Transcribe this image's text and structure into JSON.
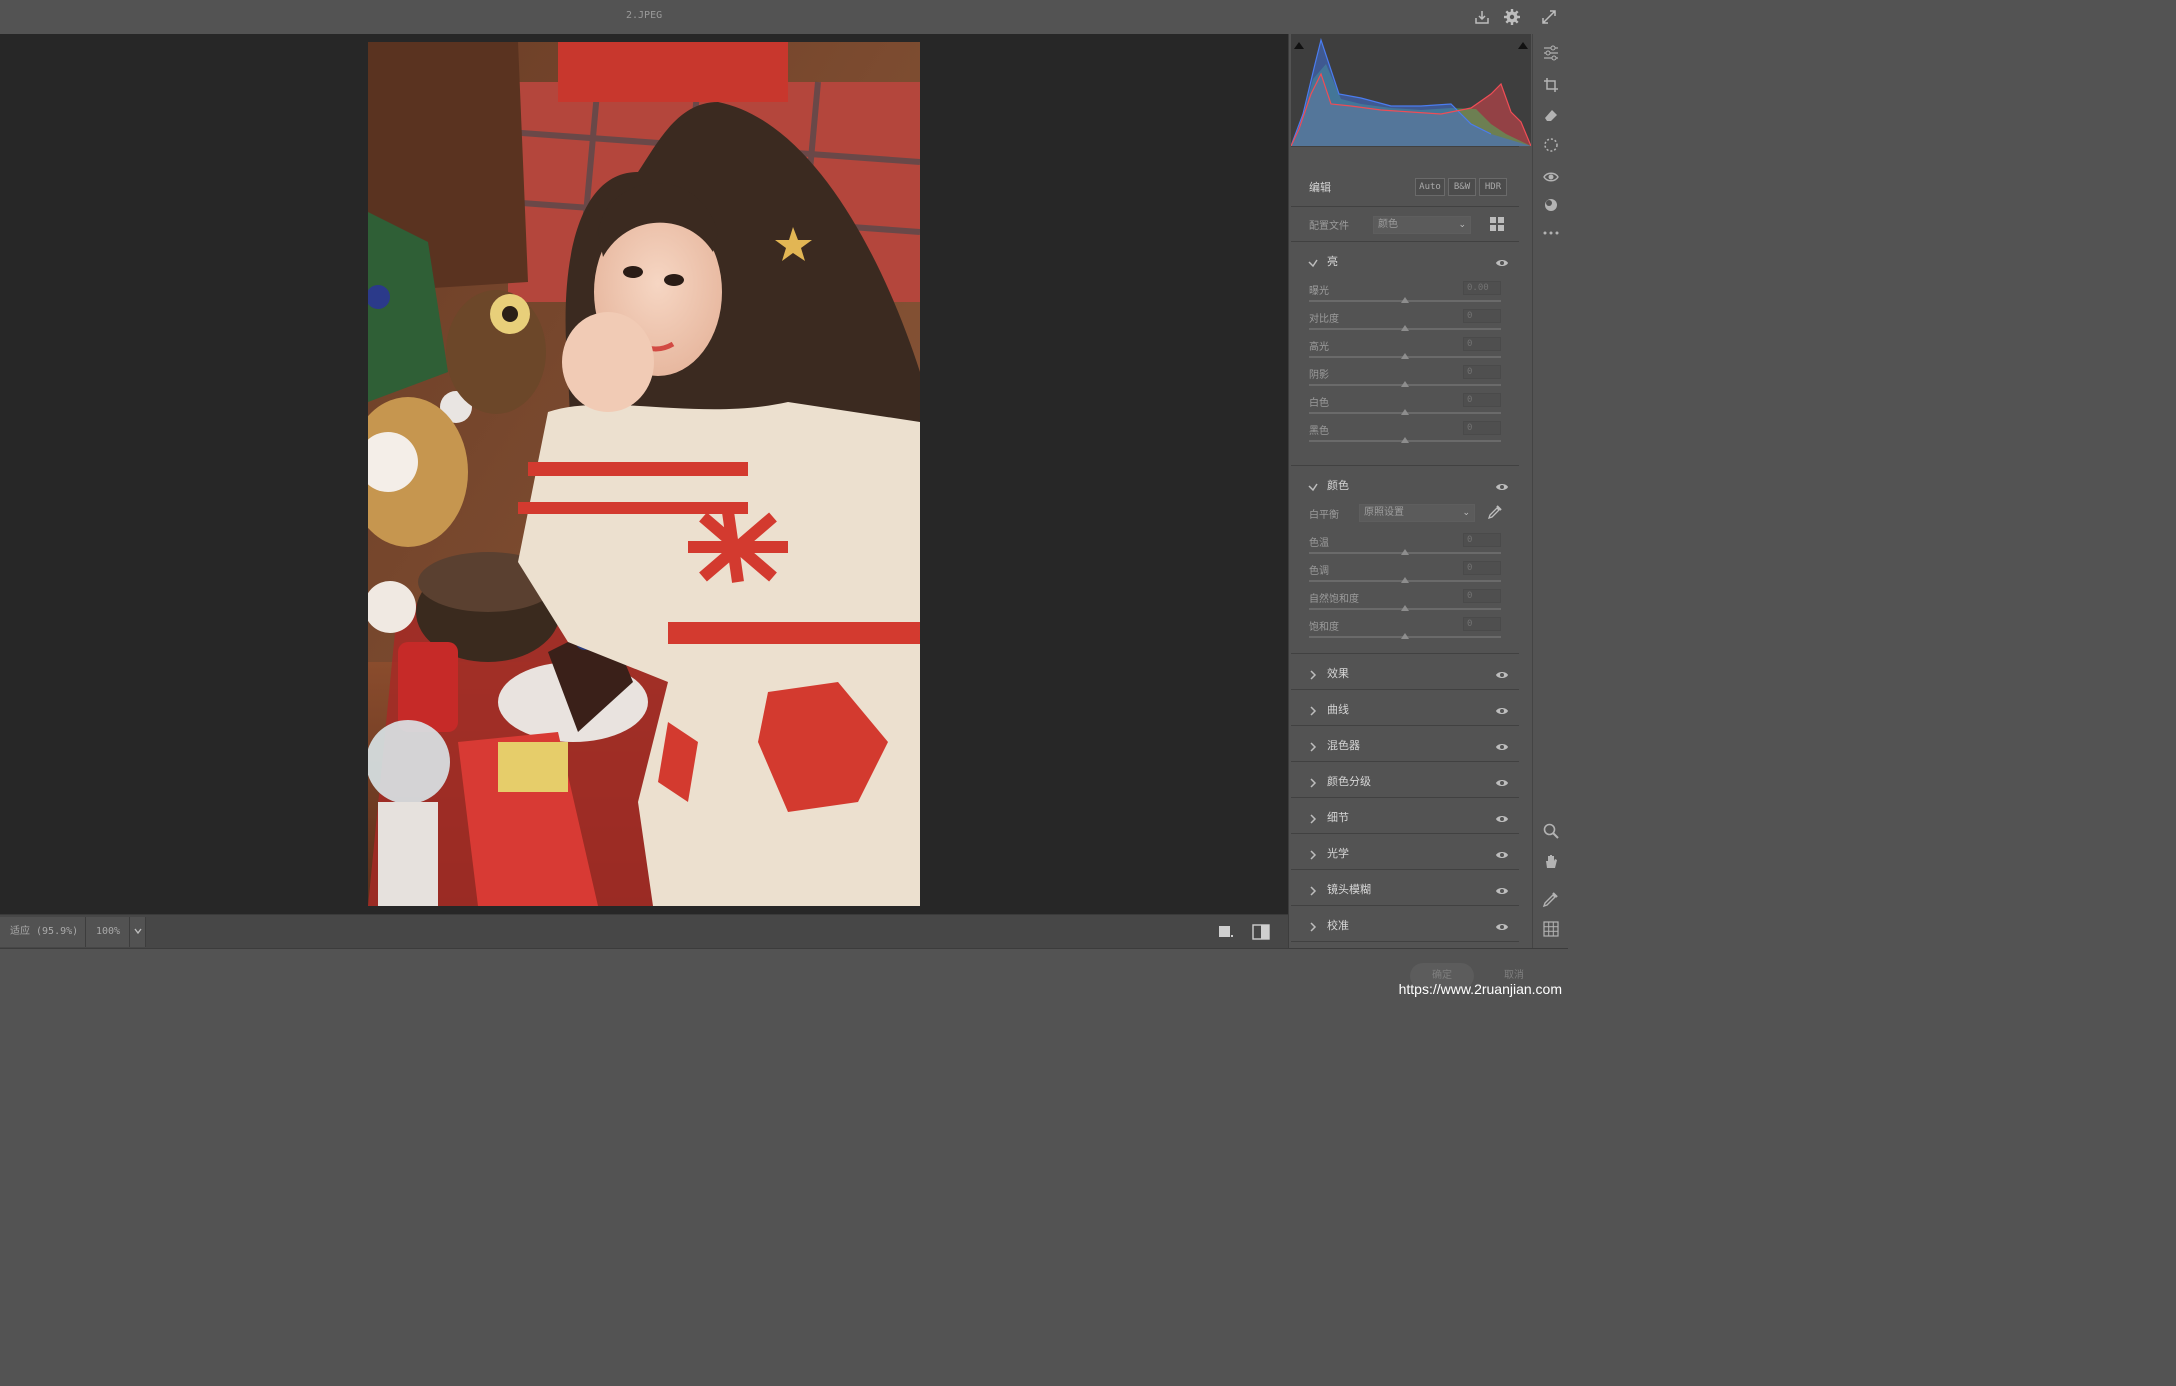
{
  "window": {
    "title": "2.JPEG"
  },
  "top_icons": [
    "save-icon",
    "gear-icon",
    "expand-icon"
  ],
  "zoom": {
    "fit_label": "适应 (95.9%)",
    "actual_label": "100%"
  },
  "panel": {
    "edit_label": "编辑",
    "buttons": {
      "auto": "Auto",
      "bw": "B&W",
      "hdr": "HDR"
    },
    "profile": {
      "label": "配置文件",
      "value": "颜色"
    },
    "light": {
      "title": "亮",
      "sliders": [
        {
          "label": "曝光",
          "value": "0.00",
          "position": 0.5
        },
        {
          "label": "对比度",
          "value": "0",
          "position": 0.5
        },
        {
          "label": "高光",
          "value": "0",
          "position": 0.5
        },
        {
          "label": "阴影",
          "value": "0",
          "position": 0.5
        },
        {
          "label": "白色",
          "value": "0",
          "position": 0.5
        },
        {
          "label": "黑色",
          "value": "0",
          "position": 0.5
        }
      ]
    },
    "color": {
      "title": "颜色",
      "white_balance": {
        "label": "白平衡",
        "value": "原照设置"
      },
      "sliders": [
        {
          "label": "色温",
          "value": "0",
          "position": 0.5
        },
        {
          "label": "色调",
          "value": "0",
          "position": 0.5
        },
        {
          "label": "自然饱和度",
          "value": "0",
          "position": 0.5
        },
        {
          "label": "饱和度",
          "value": "0",
          "position": 0.5
        }
      ]
    },
    "collapsed_sections": [
      "效果",
      "曲线",
      "混色器",
      "颜色分级",
      "细节",
      "光学",
      "镜头模糊",
      "校准"
    ]
  },
  "footer": {
    "ok": "确定",
    "cancel": "取消"
  },
  "watermark": "https://www.2ruanjian.com",
  "colors": {
    "bg": "#535353",
    "canvas": "#272727",
    "histo_red": "#d8434b",
    "histo_green": "#4fb35c",
    "histo_blue": "#3f6fd6"
  }
}
